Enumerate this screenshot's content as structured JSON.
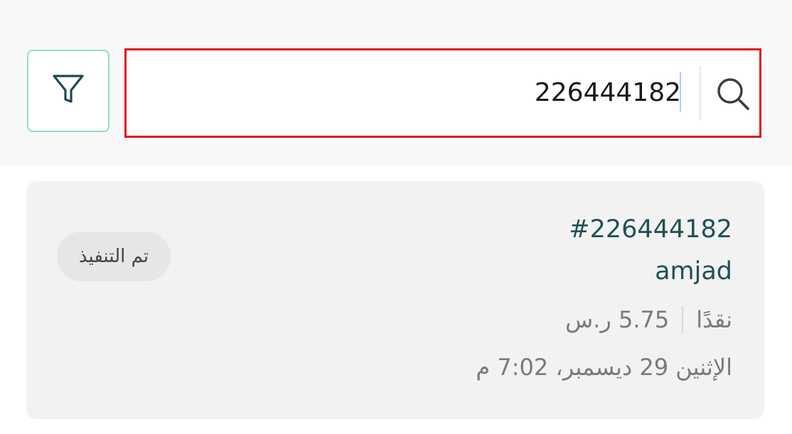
{
  "search": {
    "value": "226444182",
    "placeholder": ""
  },
  "filter_button": {
    "icon": "filter-icon"
  },
  "search_button": {
    "icon": "search-icon"
  },
  "order": {
    "number": "#226444182",
    "customer_name": "amjad",
    "amount": "5.75 ر.س",
    "payment_method": "نقدًا",
    "date": "الإثنين 29 ديسمبر، 7:02 م",
    "status": "تم التنفيذ"
  },
  "colors": {
    "accent_teal": "#1f5157",
    "filter_border": "#8fdcd0",
    "search_highlight_border": "#e0121b"
  }
}
